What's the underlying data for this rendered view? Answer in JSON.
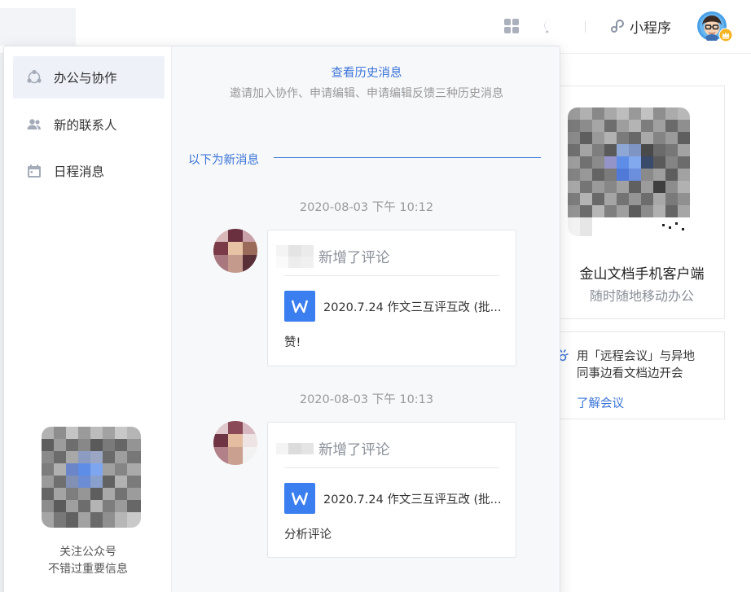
{
  "header": {
    "miniprogram_label": "小程序",
    "icons": [
      "apps-grid-icon",
      "chat-bubble-icon",
      "link-icon",
      "avatar",
      "crown-badge-icon"
    ]
  },
  "background_panel": {
    "app_title": "金山文档手机客户端",
    "app_subtitle": "随时随地移动办公",
    "meeting_line1": "用「远程会议」与异地",
    "meeting_line2": "同事边看文档边开会",
    "meeting_link": "了解会议"
  },
  "popup": {
    "sidebar": {
      "items": [
        {
          "label": "办公与协作",
          "icon": "collaboration-icon",
          "active": true
        },
        {
          "label": "新的联系人",
          "icon": "contacts-icon",
          "active": false
        },
        {
          "label": "日程消息",
          "icon": "calendar-icon",
          "active": false
        }
      ],
      "qr_caption_line1": "关注公众号",
      "qr_caption_line2": "不错过重要信息"
    },
    "main": {
      "history_link": "查看历史消息",
      "history_desc": "邀请加入协作、申请编辑、申请编辑反馈三种历史消息",
      "new_divider_label": "以下为新消息",
      "messages": [
        {
          "timestamp": "2020-08-03 下午 10:12",
          "action": "新增了评论",
          "doc_title": "2020.7.24 作文三互评互改 (批...",
          "comment": "赞!"
        },
        {
          "timestamp": "2020-08-03 下午 10:13",
          "action": "新增了评论",
          "doc_title": "2020.7.24 作文三互评互改 (批...",
          "comment": "分析评论"
        }
      ]
    }
  },
  "colors": {
    "accent_blue": "#3b74d8",
    "doc_icon_blue": "#3b7ef0",
    "muted_text": "#999999",
    "active_item_bg": "#eef2f8"
  }
}
